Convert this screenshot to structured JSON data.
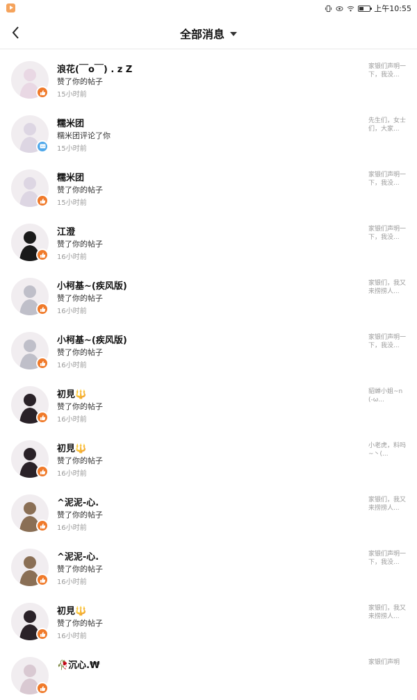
{
  "status_bar": {
    "time": "上午10:55",
    "icons": [
      "vibrate-icon",
      "eye-icon",
      "wifi-icon",
      "battery-icon"
    ]
  },
  "header": {
    "title": "全部消息"
  },
  "colors": {
    "like_badge": "#f07a2a",
    "comment_badge": "#4ea7ea",
    "time_text": "#999999",
    "preview_text": "#9a9a9a"
  },
  "messages": [
    {
      "name": "浪花(￣o￣) . z Z",
      "action": "赞了你的帖子",
      "time": "15小时前",
      "preview": "家银们声明一下，我没...",
      "type": "like",
      "avatar_color": "#e9d8e4"
    },
    {
      "name": "糯米团",
      "action": "糯米团评论了你",
      "time": "15小时前",
      "preview": "先生们，女士们，大家...",
      "type": "comment",
      "avatar_color": "#ddd6e3"
    },
    {
      "name": "糯米团",
      "action": "赞了你的帖子",
      "time": "15小时前",
      "preview": "家银们声明一下，我没...",
      "type": "like",
      "avatar_color": "#ddd6e3"
    },
    {
      "name": "江澄",
      "action": "赞了你的帖子",
      "time": "16小时前",
      "preview": "家银们声明一下，我没...",
      "type": "like",
      "avatar_color": "#1a1a1a"
    },
    {
      "name": "小柯基~(疾风版)",
      "action": "赞了你的帖子",
      "time": "16小时前",
      "preview": "家银们，我又来捞捞人...",
      "type": "like",
      "avatar_color": "#bfbfc9"
    },
    {
      "name": "小柯基~(疾风版)",
      "action": "赞了你的帖子",
      "time": "16小时前",
      "preview": "家银们声明一下，我没...",
      "type": "like",
      "avatar_color": "#bfbfc9"
    },
    {
      "name": "初見🔱",
      "action": "赞了你的帖子",
      "time": "16小时前",
      "preview": "貂蝉小姐~n(-ω...",
      "type": "like",
      "avatar_color": "#2a2228"
    },
    {
      "name": "初見🔱",
      "action": "赞了你的帖子",
      "time": "16小时前",
      "preview": "小老虎，料吗~丶(...",
      "type": "like",
      "avatar_color": "#2a2228"
    },
    {
      "name": "^泥泥-心.",
      "action": "赞了你的帖子",
      "time": "16小时前",
      "preview": "家银们，我又来捞捞人...",
      "type": "like",
      "avatar_color": "#8a6f55"
    },
    {
      "name": "^泥泥-心.",
      "action": "赞了你的帖子",
      "time": "16小时前",
      "preview": "家银们声明一下，我没...",
      "type": "like",
      "avatar_color": "#8a6f55"
    },
    {
      "name": "初見🔱",
      "action": "赞了你的帖子",
      "time": "16小时前",
      "preview": "家银们，我又来捞捞人...",
      "type": "like",
      "avatar_color": "#2a2228"
    },
    {
      "name": "🥀沉心.₩",
      "action": "",
      "time": "",
      "preview": "家银们声明",
      "type": "like",
      "avatar_color": "#d9c9d2"
    }
  ]
}
